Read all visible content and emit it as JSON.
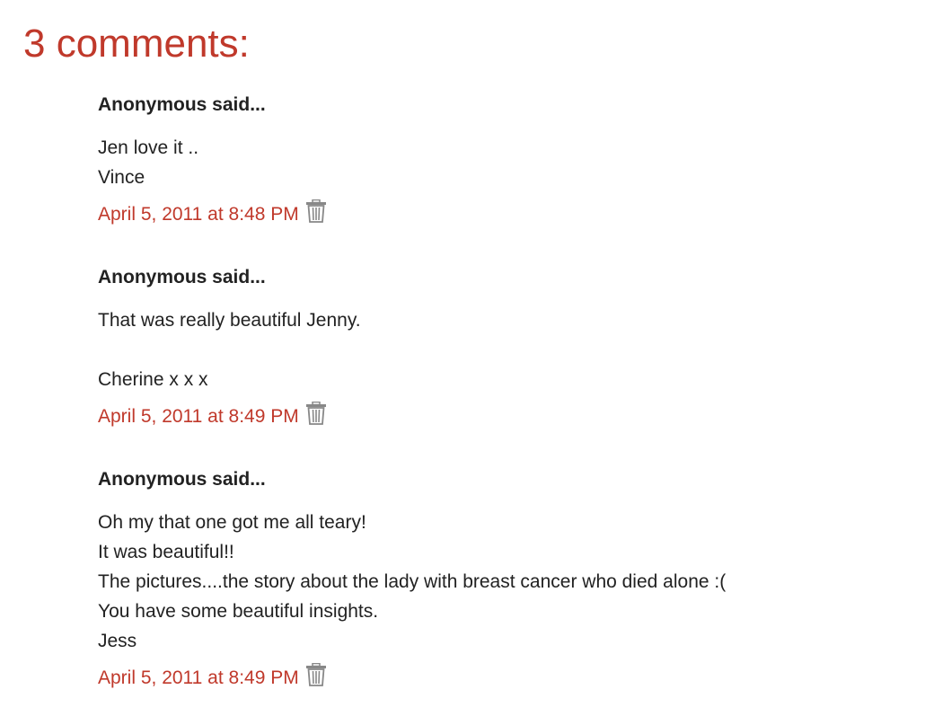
{
  "heading": "3 comments:",
  "comments": [
    {
      "author": "Anonymous said...",
      "lines": [
        "Jen love it ..",
        "Vince"
      ],
      "timestamp": "April 5, 2011 at 8:48 PM",
      "delete_icon": "trash-icon"
    },
    {
      "author": "Anonymous said...",
      "lines": [
        "That was really beautiful Jenny.",
        "",
        "Cherine x x x"
      ],
      "timestamp": "April 5, 2011 at 8:49 PM",
      "delete_icon": "trash-icon"
    },
    {
      "author": "Anonymous said...",
      "lines": [
        "Oh my that one got me all teary!",
        "It was beautiful!!",
        "The pictures....the story about the lady with breast cancer who died alone :(",
        "You have some beautiful insights.",
        "Jess"
      ],
      "timestamp": "April 5, 2011 at 8:49 PM",
      "delete_icon": "trash-icon"
    }
  ],
  "colors": {
    "accent": "#c0392b",
    "text": "#222222",
    "icon": "#888888"
  }
}
